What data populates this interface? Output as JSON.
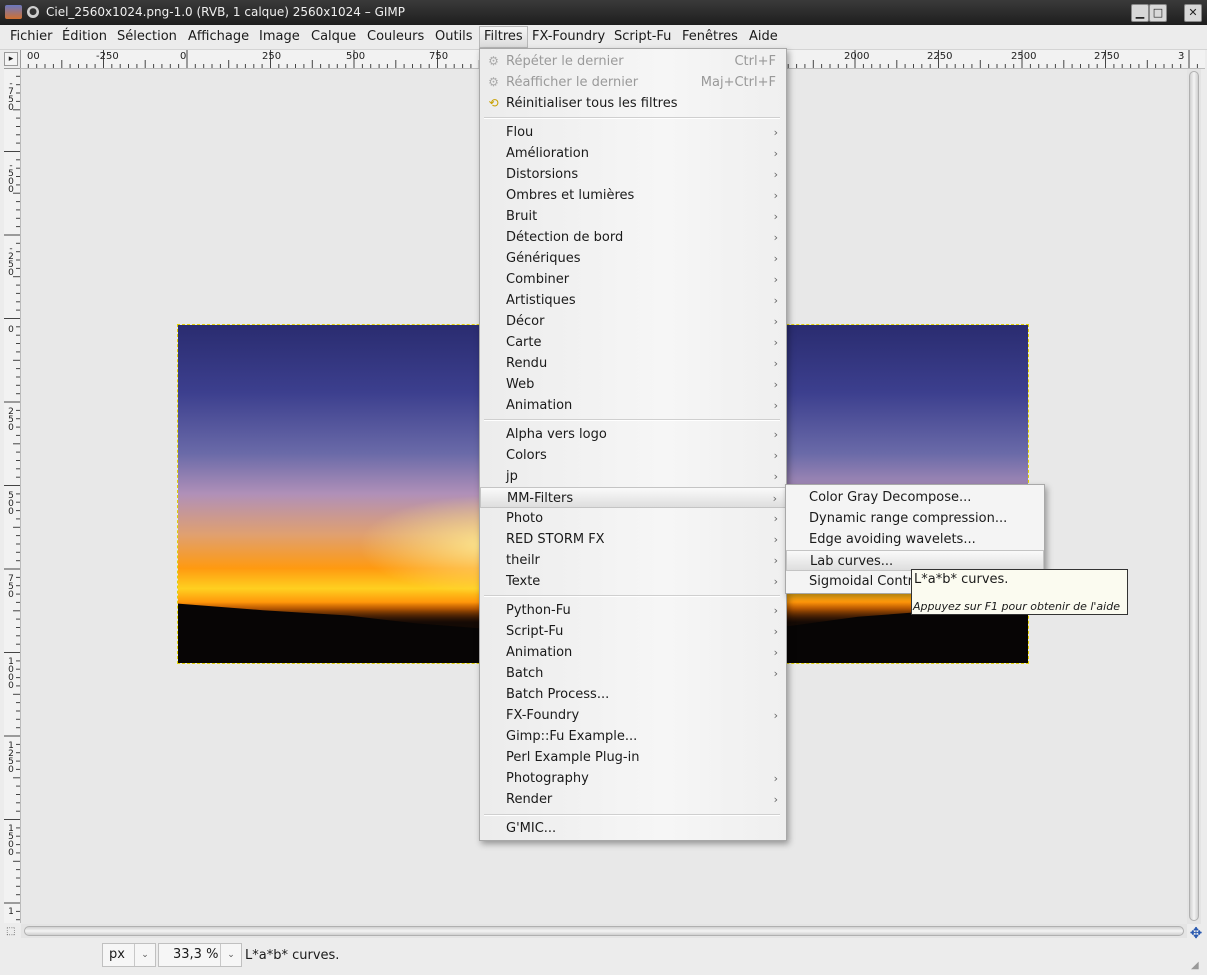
{
  "window": {
    "title": "Ciel_2560x1024.png-1.0 (RVB, 1 calque) 2560x1024 – GIMP",
    "minimize": "▁",
    "maximize": "□",
    "close": "✕"
  },
  "menubar": {
    "items": [
      {
        "label": "Fichier"
      },
      {
        "label": "Édition"
      },
      {
        "label": "Sélection"
      },
      {
        "label": "Affichage"
      },
      {
        "label": "Image"
      },
      {
        "label": "Calque"
      },
      {
        "label": "Couleurs"
      },
      {
        "label": "Outils"
      },
      {
        "label": "Filtres",
        "active": true
      },
      {
        "label": "FX-Foundry"
      },
      {
        "label": "Script-Fu"
      },
      {
        "label": "Fenêtres"
      },
      {
        "label": "Aide"
      }
    ]
  },
  "rulers": {
    "horizontal": [
      "00",
      "-250",
      "0",
      "250",
      "500",
      "750",
      "2000",
      "2250",
      "2500",
      "2750",
      "3"
    ],
    "vertical": [
      "-\n7\n5\n0",
      "-\n5\n0\n0",
      "-\n2\n5\n0",
      "0",
      "2\n5\n0",
      "5\n0\n0",
      "7\n5\n0",
      "1\n0\n0\n0",
      "1\n2\n5\n0",
      "1\n5\n0\n0",
      "1"
    ]
  },
  "filters_menu": {
    "top": [
      {
        "label": "Répéter le dernier",
        "accel": "Ctrl+F",
        "disabled": true,
        "icon": "repeat-icon"
      },
      {
        "label": "Réafficher le dernier",
        "accel": "Maj+Ctrl+F",
        "disabled": true,
        "icon": "reshow-icon"
      },
      {
        "label": "Réinitialiser tous les filtres",
        "accel": "",
        "disabled": false,
        "icon": "reset-icon"
      }
    ],
    "group1": [
      "Flou",
      "Amélioration",
      "Distorsions",
      "Ombres et lumières",
      "Bruit",
      "Détection de bord",
      "Génériques",
      "Combiner",
      "Artistiques",
      "Décor",
      "Carte",
      "Rendu",
      "Web",
      "Animation"
    ],
    "group2": [
      "Alpha vers logo",
      "Colors",
      "jp",
      "MM-Filters",
      "Photo",
      "RED STORM FX",
      "theilr",
      "Texte"
    ],
    "group3": [
      {
        "label": "Python-Fu",
        "submenu": true
      },
      {
        "label": "Script-Fu",
        "submenu": true
      },
      {
        "label": "Animation",
        "submenu": true
      },
      {
        "label": "Batch",
        "submenu": true
      },
      {
        "label": "Batch Process...",
        "submenu": false
      },
      {
        "label": "FX-Foundry",
        "submenu": true
      },
      {
        "label": "Gimp::Fu Example...",
        "submenu": false
      },
      {
        "label": "Perl Example Plug-in",
        "submenu": false
      },
      {
        "label": "Photography",
        "submenu": true
      },
      {
        "label": "Render",
        "submenu": true
      }
    ],
    "group4": [
      "G'MIC..."
    ],
    "submenu_arrow": "›"
  },
  "mm_filters_menu": {
    "items": [
      "Color Gray Decompose...",
      "Dynamic range compression...",
      "Edge avoiding wavelets...",
      "Lab curves...",
      "Sigmoidal Contr"
    ],
    "highlighted": "Lab curves..."
  },
  "tooltip": {
    "text": "L*a*b* curves.",
    "hint": "Appuyez sur F1 pour obtenir de l'aide"
  },
  "statusbar": {
    "unit": "px",
    "zoom": "33,3 %",
    "message": "L*a*b* curves."
  }
}
